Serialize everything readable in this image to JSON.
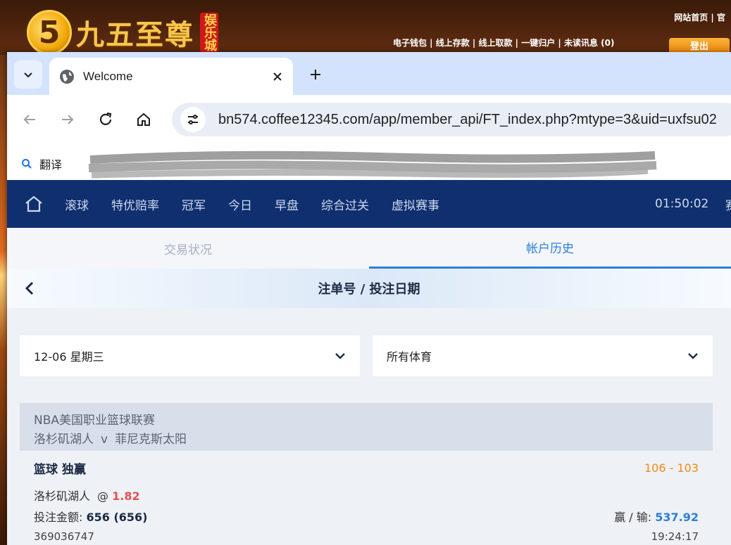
{
  "background_site": {
    "logo_text": "九五至尊",
    "logo_badge": "娱乐城",
    "top_links": "网站首页 | 官",
    "nav_links": "电子钱包 | 线上存款 | 线上取款 | 一键归户 | 未读讯息 (0)",
    "login_label": "登出"
  },
  "browser": {
    "tab_title": "Welcome",
    "url": "bn574.coffee12345.com/app/member_api/FT_index.php?mtype=3&uid=uxfsu02",
    "bookmarks": [
      {
        "label": "翻译",
        "icon": "search-icon"
      }
    ]
  },
  "topnav": {
    "items": [
      "滚球",
      "特优赔率",
      "冠军",
      "今日",
      "早盘",
      "综合过关",
      "虚拟赛事"
    ],
    "clock": "01:50:02",
    "more": "赛"
  },
  "subtabs": [
    {
      "label": "交易状况",
      "active": false
    },
    {
      "label": "帐户历史",
      "active": true
    }
  ],
  "title": "注单号 / 投注日期",
  "filters": {
    "date": "12-06 星期三",
    "sport": "所有体育"
  },
  "bet": {
    "league": "NBA美国职业篮球联赛",
    "home": "洛杉矶湖人",
    "vs": "v",
    "away": "菲尼克斯太阳",
    "type": "篮球 独赢",
    "score": "106 - 103",
    "pick": "洛杉矶湖人",
    "odds_at": "@",
    "odds": "1.82",
    "stake_label": "投注金额:",
    "stake_value": "656 (656)",
    "winloss_label": "赢 / 输:",
    "winloss_value": "537.92",
    "bet_id": "369036747",
    "time": "19:24:17"
  },
  "colors": {
    "nav_bg": "#0f2f6e",
    "accent": "#2b7fd6",
    "score": "#f08a14",
    "odds": "#e35050"
  }
}
